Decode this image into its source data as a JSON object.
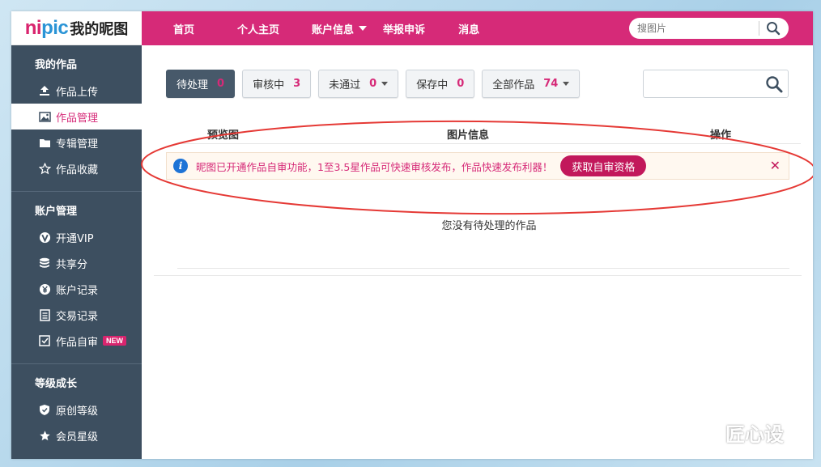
{
  "logo": {
    "en_part1": "ni",
    "en_part2": "pic",
    "cn": "我的昵图"
  },
  "nav": {
    "items": [
      {
        "label": "首页"
      },
      {
        "label": "个人主页"
      },
      {
        "label": "账户信息",
        "has_caret": true
      },
      {
        "label": "举报申诉"
      },
      {
        "label": "消息"
      }
    ],
    "search_placeholder": "搜图片"
  },
  "sidebar": {
    "groups": [
      {
        "title": "我的作品",
        "items": [
          {
            "label": "作品上传",
            "icon": "upload-icon"
          },
          {
            "label": "作品管理",
            "icon": "image-icon",
            "active": true
          },
          {
            "label": "专辑管理",
            "icon": "folder-icon"
          },
          {
            "label": "作品收藏",
            "icon": "star-outline-icon"
          }
        ]
      },
      {
        "title": "账户管理",
        "items": [
          {
            "label": "开通VIP",
            "icon": "vip-icon"
          },
          {
            "label": "共享分",
            "icon": "coins-icon"
          },
          {
            "label": "账户记录",
            "icon": "yen-icon"
          },
          {
            "label": "交易记录",
            "icon": "ledger-icon"
          },
          {
            "label": "作品自审",
            "icon": "self-review-icon",
            "badge": "NEW"
          }
        ]
      },
      {
        "title": "等级成长",
        "items": [
          {
            "label": "原创等级",
            "icon": "shield-icon"
          },
          {
            "label": "会员星级",
            "icon": "star-icon"
          }
        ]
      }
    ]
  },
  "filters": [
    {
      "label": "待处理",
      "count": "0",
      "active": true
    },
    {
      "label": "审核中",
      "count": "3"
    },
    {
      "label": "未通过",
      "count": "0",
      "dropdown": true
    },
    {
      "label": "保存中",
      "count": "0"
    },
    {
      "label": "全部作品",
      "count": "74",
      "dropdown": true
    }
  ],
  "table": {
    "col_preview": "预览图",
    "col_info": "图片信息",
    "col_action": "操作"
  },
  "notice": {
    "text": "昵图已开通作品自审功能，1至3.5星作品可快速审核发布，作品快速发布利器！",
    "button": "获取自审资格",
    "close": "✕"
  },
  "empty_text": "您没有待处理的作品",
  "watermark": "匠心设",
  "colors": {
    "brand": "#d62a78",
    "sidebar": "#3d4f60",
    "annotation": "#e53935"
  }
}
